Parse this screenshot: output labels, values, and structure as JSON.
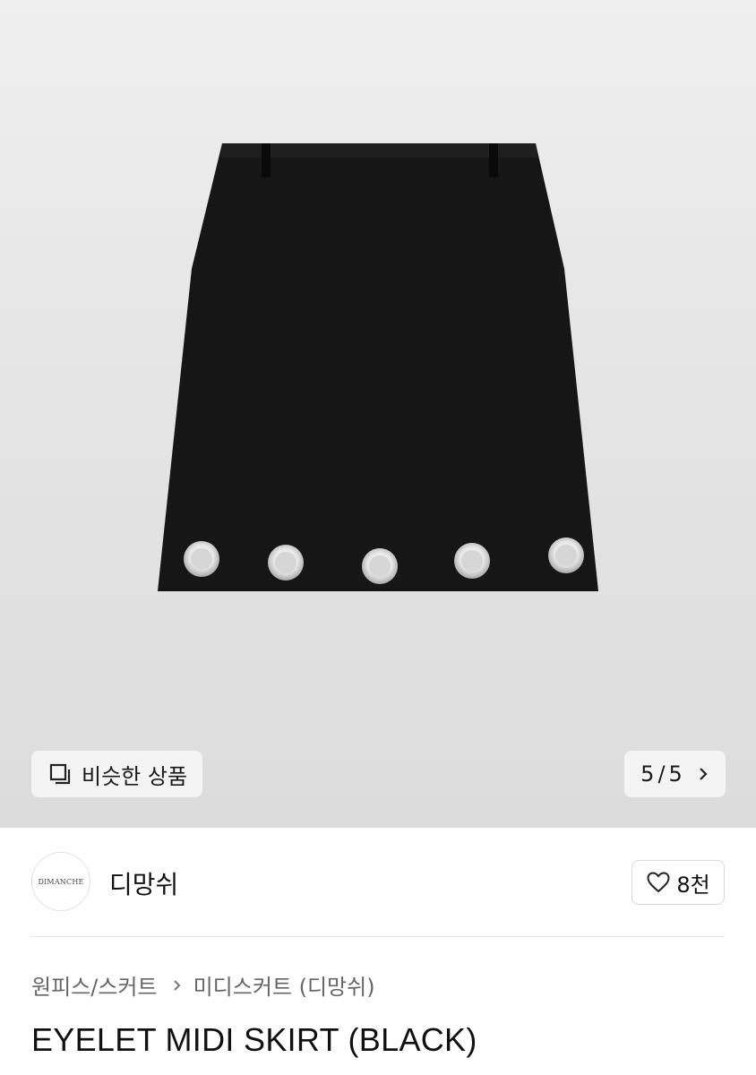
{
  "similar_button": {
    "label": "비슷한 상품"
  },
  "pager": {
    "current": "5",
    "separator": "/",
    "total": "5"
  },
  "seller": {
    "logo_text": "DIMANCHE",
    "name": "디망쉬"
  },
  "like": {
    "count": "8천"
  },
  "breadcrumb": {
    "category": "원피스/스커트",
    "subcategory": "미디스커트 (디망쉬)"
  },
  "product": {
    "title": "EYELET MIDI SKIRT (BLACK)"
  },
  "icons": {
    "similar": "stacked-squares-icon",
    "chevron": "chevron-right-icon",
    "heart": "heart-icon"
  }
}
